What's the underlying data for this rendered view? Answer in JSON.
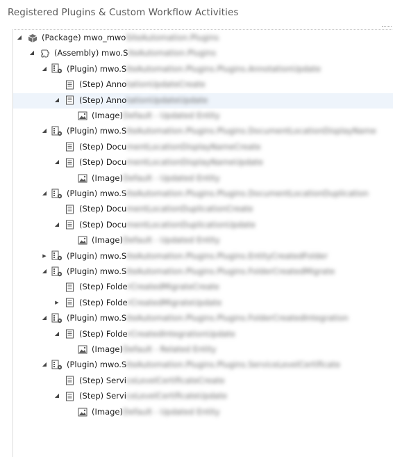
{
  "header": {
    "title": "Registered Plugins & Custom Workflow Activities"
  },
  "tree": {
    "nodes": [
      {
        "level": 0,
        "toggle": "expanded",
        "icon": "package-icon",
        "label": "(Package) mwo_mwo",
        "hidden": "SiteAutomation.Plugins",
        "selected": false
      },
      {
        "level": 1,
        "toggle": "expanded",
        "icon": "assembly-icon",
        "label": "(Assembly) mwo.S",
        "hidden": "iteAutomation.Plugins",
        "selected": false
      },
      {
        "level": 2,
        "toggle": "expanded",
        "icon": "plugin-icon",
        "label": "(Plugin) mwo.S",
        "hidden": "iteAutomation.Plugins.Plugins.AnnotationUpdate",
        "selected": false
      },
      {
        "level": 3,
        "toggle": "none",
        "icon": "step-icon",
        "label": "(Step) Anno",
        "hidden": "tationUpdateCreate",
        "selected": false
      },
      {
        "level": 3,
        "toggle": "expanded",
        "icon": "step-icon",
        "label": "(Step) Anno",
        "hidden": "tationUpdateUpdate",
        "selected": true
      },
      {
        "level": 4,
        "toggle": "none",
        "icon": "image-icon",
        "label": "(Image)",
        "hidden": "Default - Updated Entity",
        "selected": false
      },
      {
        "level": 2,
        "toggle": "expanded",
        "icon": "plugin-icon",
        "label": "(Plugin) mwo.S",
        "hidden": "iteAutomation.Plugins.Plugins.DocumentLocationDisplayName",
        "selected": false
      },
      {
        "level": 3,
        "toggle": "none",
        "icon": "step-icon",
        "label": "(Step) Docu",
        "hidden": "mentLocationDisplayNameCreate",
        "selected": false
      },
      {
        "level": 3,
        "toggle": "expanded",
        "icon": "step-icon",
        "label": "(Step) Docu",
        "hidden": "mentLocationDisplayNameUpdate",
        "selected": false
      },
      {
        "level": 4,
        "toggle": "none",
        "icon": "image-icon",
        "label": "(Image)",
        "hidden": "Default - Updated Entity",
        "selected": false
      },
      {
        "level": 2,
        "toggle": "expanded",
        "icon": "plugin-icon",
        "label": "(Plugin) mwo.S",
        "hidden": "iteAutomation.Plugins.Plugins.DocumentLocationDuplication",
        "selected": false
      },
      {
        "level": 3,
        "toggle": "none",
        "icon": "step-icon",
        "label": "(Step) Docu",
        "hidden": "mentLocationDuplicationCreate",
        "selected": false
      },
      {
        "level": 3,
        "toggle": "expanded",
        "icon": "step-icon",
        "label": "(Step) Docu",
        "hidden": "mentLocationDuplicationUpdate",
        "selected": false
      },
      {
        "level": 4,
        "toggle": "none",
        "icon": "image-icon",
        "label": "(Image)",
        "hidden": "Default - Updated Entity",
        "selected": false
      },
      {
        "level": 2,
        "toggle": "collapsed",
        "icon": "plugin-icon",
        "label": "(Plugin) mwo.S",
        "hidden": "iteAutomation.Plugins.Plugins.EntityCreatedFolder",
        "selected": false
      },
      {
        "level": 2,
        "toggle": "expanded",
        "icon": "plugin-icon",
        "label": "(Plugin) mwo.S",
        "hidden": "iteAutomation.Plugins.Plugins.FolderCreatedMigrate",
        "selected": false
      },
      {
        "level": 3,
        "toggle": "none",
        "icon": "step-icon",
        "label": "(Step) Folde",
        "hidden": "rCreatedMigrateCreate",
        "selected": false
      },
      {
        "level": 3,
        "toggle": "collapsed",
        "icon": "step-icon",
        "label": "(Step) Folde",
        "hidden": "rCreatedMigrateUpdate",
        "selected": false
      },
      {
        "level": 2,
        "toggle": "expanded",
        "icon": "plugin-icon",
        "label": "(Plugin) mwo.S",
        "hidden": "iteAutomation.Plugins.Plugins.FolderCreatedIntegration",
        "selected": false
      },
      {
        "level": 3,
        "toggle": "expanded",
        "icon": "step-icon",
        "label": "(Step) Folde",
        "hidden": "rCreatedIntegrationUpdate",
        "selected": false
      },
      {
        "level": 4,
        "toggle": "none",
        "icon": "image-icon",
        "label": "(Image)",
        "hidden": "Default - Related Entity",
        "selected": false
      },
      {
        "level": 2,
        "toggle": "expanded",
        "icon": "plugin-icon",
        "label": "(Plugin) mwo.S",
        "hidden": "iteAutomation.Plugins.Plugins.ServiceLevelCertificate",
        "selected": false
      },
      {
        "level": 3,
        "toggle": "none",
        "icon": "step-icon",
        "label": "(Step) Servi",
        "hidden": "ceLevelCertificateCreate",
        "selected": false
      },
      {
        "level": 3,
        "toggle": "expanded",
        "icon": "step-icon",
        "label": "(Step) Servi",
        "hidden": "ceLevelCertificateUpdate",
        "selected": false
      },
      {
        "level": 4,
        "toggle": "none",
        "icon": "image-icon",
        "label": "(Image)",
        "hidden": "Default - Updated Entity",
        "selected": false
      }
    ]
  }
}
